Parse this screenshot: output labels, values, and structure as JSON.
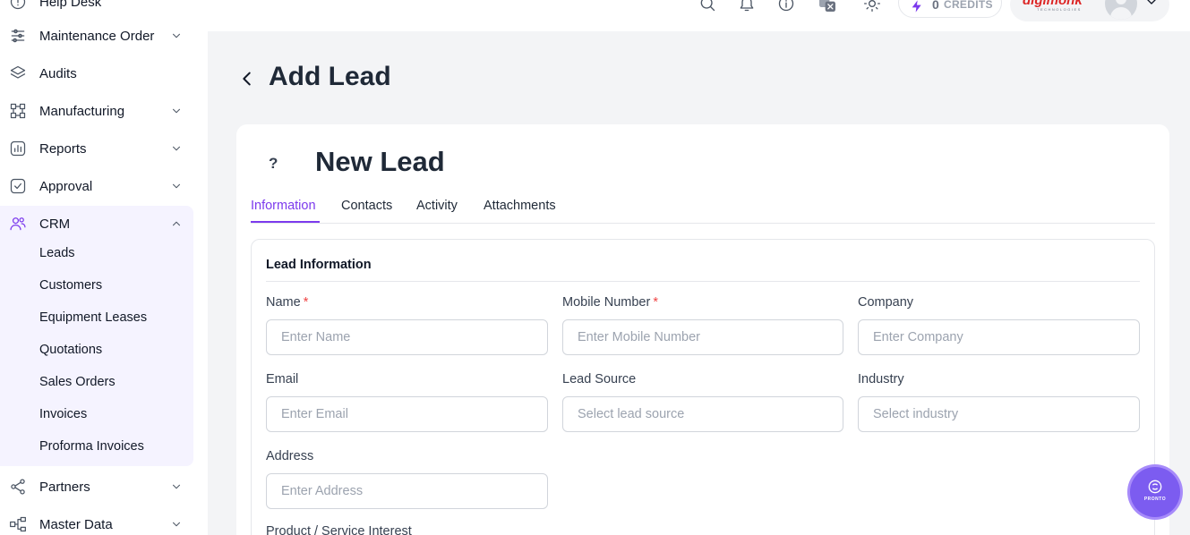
{
  "sidebar": {
    "items": [
      {
        "label": "Help Desk"
      },
      {
        "label": "Maintenance Order"
      },
      {
        "label": "Audits"
      },
      {
        "label": "Manufacturing"
      },
      {
        "label": "Reports"
      },
      {
        "label": "Approval"
      },
      {
        "label": "CRM"
      },
      {
        "label": "Partners"
      },
      {
        "label": "Master Data"
      }
    ],
    "crm_sub": [
      "Leads",
      "Customers",
      "Equipment Leases",
      "Quotations",
      "Sales Orders",
      "Invoices",
      "Proforma Invoices"
    ]
  },
  "topbar": {
    "credits_count": "0",
    "credits_label": "CREDITS",
    "brand": "digimonk",
    "brand_sub": "TECHNOLOGIES"
  },
  "page": {
    "title": "Add Lead"
  },
  "card": {
    "icon_glyph": "?",
    "title": "New Lead",
    "tabs": [
      "Information",
      "Contacts",
      "Activity",
      "Attachments"
    ],
    "section_title": "Lead Information",
    "fields": {
      "name": {
        "label": "Name",
        "placeholder": "Enter Name",
        "required": "*"
      },
      "mobile": {
        "label": "Mobile Number",
        "placeholder": "Enter Mobile Number",
        "required": "*"
      },
      "company": {
        "label": "Company",
        "placeholder": "Enter Company"
      },
      "email": {
        "label": "Email",
        "placeholder": "Enter Email"
      },
      "lead_source": {
        "label": "Lead Source",
        "placeholder": "Select lead source"
      },
      "industry": {
        "label": "Industry",
        "placeholder": "Select industry"
      },
      "address": {
        "label": "Address",
        "placeholder": "Enter Address"
      },
      "product_interest": {
        "label": "Product / Service Interest"
      }
    }
  },
  "fab": {
    "label": "PRONTO"
  },
  "colors": {
    "accent": "#7c3aed",
    "required": "#ef4444",
    "brand": "#dc2626"
  }
}
